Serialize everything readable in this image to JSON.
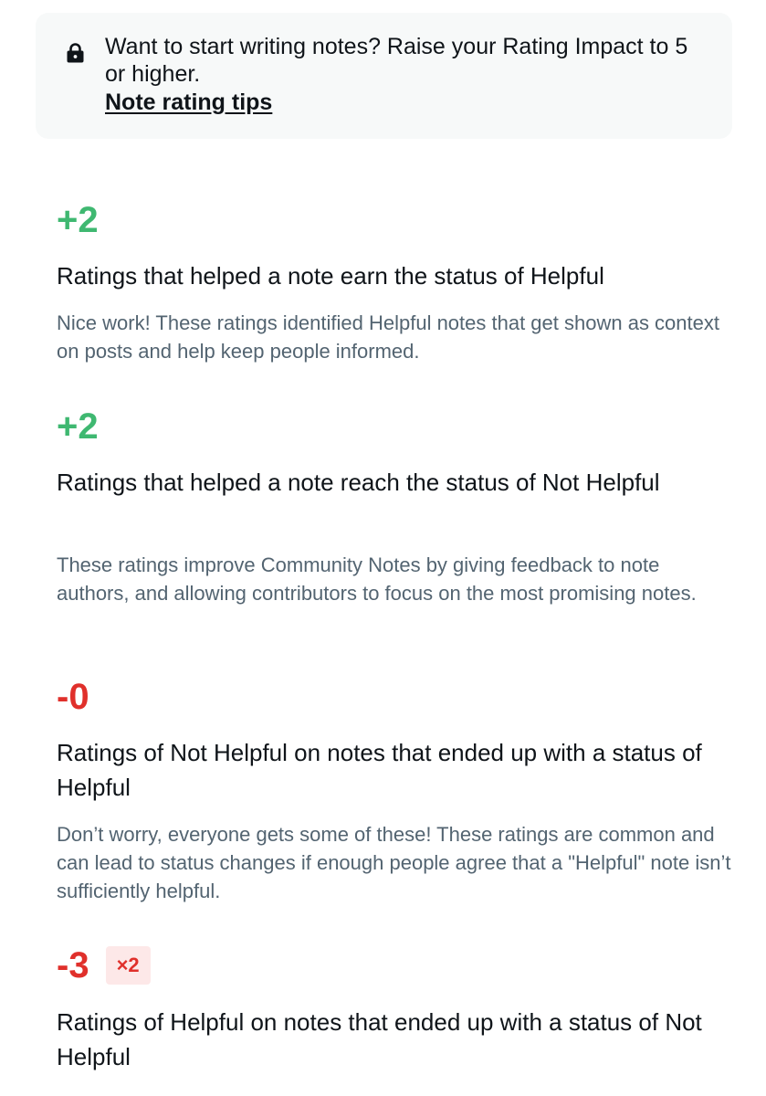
{
  "banner": {
    "icon": "lock-icon",
    "message": "Want to start writing notes? Raise your Rating Impact to 5 or higher.",
    "link_label": "Note rating tips"
  },
  "colors": {
    "positive": "#3fb871",
    "negative": "#e0302b",
    "banner_bg": "#f7f9f9",
    "secondary_text": "#536471"
  },
  "sections": [
    {
      "impact": "+2",
      "heading": "Ratings that helped a note earn the status of Helpful",
      "description": "Nice work! These ratings identified Helpful notes that get shown as context on posts and help keep people informed."
    },
    {
      "impact": "+2",
      "heading": "Ratings that helped a note reach the status of Not Helpful",
      "description": "These ratings improve Community Notes by giving feedback to note authors, and allowing contributors to focus on the most promising notes."
    },
    {
      "impact": "-0",
      "heading": "Ratings of Not Helpful on notes that ended up with a status of Helpful",
      "description": "Don’t worry, everyone gets some of these! These ratings are common and can lead to status changes if enough people agree that a \"Helpful\" note isn’t sufficiently helpful."
    },
    {
      "impact": "-3",
      "multiplier": "×2",
      "heading": "Ratings of Helpful on notes that ended up with a status of Not Helpful"
    }
  ]
}
